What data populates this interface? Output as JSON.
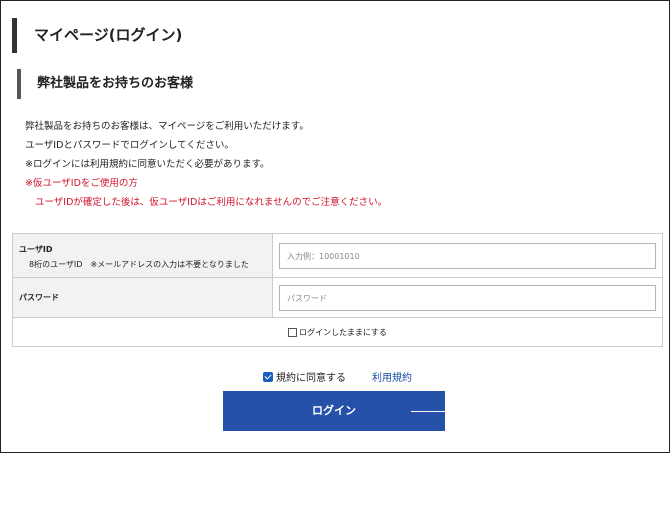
{
  "page": {
    "title": "マイページ(ログイン)"
  },
  "section": {
    "title": "弊社製品をお持ちのお客様"
  },
  "intro": {
    "line1": "弊社製品をお持ちのお客様は、マイページをご利用いただけます。",
    "line2": "ユーザIDとパスワードでログインしてください。",
    "line3": "※ログインには利用規約に同意いただく必要があります。",
    "notice_title": "※仮ユーザIDをご使用の方",
    "notice_body": "ユーザIDが確定した後は、仮ユーザIDはご利用になれませんのでご注意ください。"
  },
  "form": {
    "user_id": {
      "label": "ユーザID",
      "sub_label": "8桁のユーザID　※メールアドレスの入力は不要となりました",
      "value": "",
      "placeholder": "入力例：10001010"
    },
    "password": {
      "label": "パスワード",
      "value": "",
      "placeholder": "パスワード"
    },
    "keep_logged_in": {
      "label": "ログインしたままにする",
      "checked": false
    }
  },
  "agreement": {
    "label": "規約に同意する",
    "checked": true,
    "terms_link": "利用規約"
  },
  "login_button": {
    "label": "ログイン"
  },
  "colors": {
    "button": "#2552a8",
    "link": "#1d4fa3",
    "notice": "#d0112b",
    "checkbox": "#1c5fb8"
  }
}
